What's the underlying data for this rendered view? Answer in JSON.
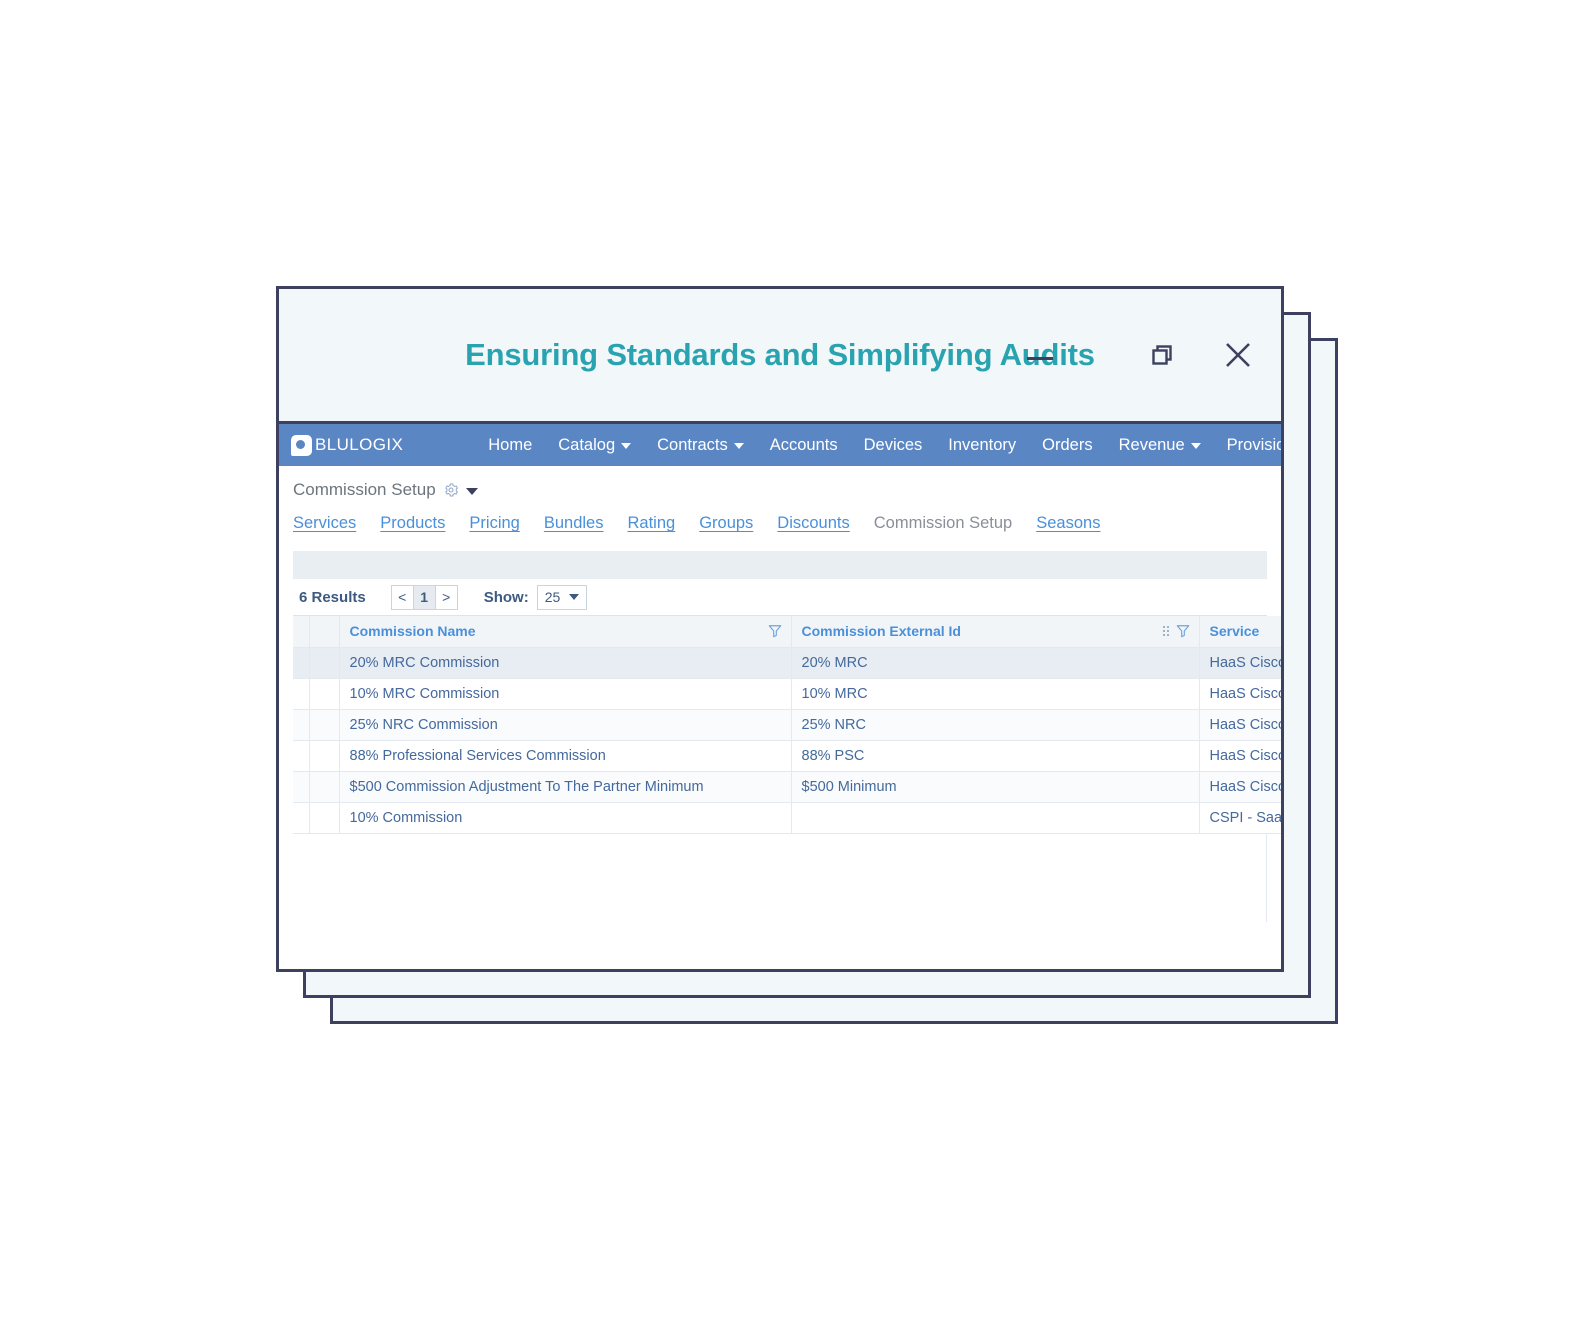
{
  "window": {
    "title": "Ensuring Standards and Simplifying Audits",
    "controls": {
      "minimize": "minimize",
      "restore": "restore",
      "close": "close"
    },
    "accent_color": "#2aa3b0",
    "border_color": "#3d405e",
    "chrome_bg": "#f2f8f9"
  },
  "navbar": {
    "brand": "BLULOGIX",
    "bg_color": "#5b86c4",
    "items": [
      {
        "label": "Home",
        "has_caret": false
      },
      {
        "label": "Catalog",
        "has_caret": true
      },
      {
        "label": "Contracts",
        "has_caret": true
      },
      {
        "label": "Accounts",
        "has_caret": false
      },
      {
        "label": "Devices",
        "has_caret": false
      },
      {
        "label": "Inventory",
        "has_caret": false
      },
      {
        "label": "Orders",
        "has_caret": false
      },
      {
        "label": "Revenue",
        "has_caret": true
      },
      {
        "label": "Provisioning",
        "has_caret": false
      }
    ]
  },
  "page": {
    "title": "Commission Setup",
    "settings_icon": "gear-icon",
    "settings_caret": "chevron-down-icon"
  },
  "subtabs": [
    {
      "label": "Services",
      "active": false
    },
    {
      "label": "Products",
      "active": false
    },
    {
      "label": "Pricing",
      "active": false
    },
    {
      "label": "Bundles",
      "active": false
    },
    {
      "label": "Rating",
      "active": false
    },
    {
      "label": "Groups",
      "active": false
    },
    {
      "label": "Discounts",
      "active": false
    },
    {
      "label": "Commission Setup",
      "active": true
    },
    {
      "label": "Seasons",
      "active": false
    }
  ],
  "results_bar": {
    "count_label": "6 Results",
    "pager": {
      "prev": "<",
      "current_page": "1",
      "next": ">"
    },
    "show_label": "Show:",
    "show_value": "25"
  },
  "table": {
    "columns": [
      {
        "label": "Commission Name",
        "filter_icon": "funnel-icon",
        "drag_handle": false
      },
      {
        "label": "Commission External Id",
        "filter_icon": "funnel-icon",
        "drag_handle": true
      },
      {
        "label": "Service",
        "filter_icon": null,
        "drag_handle": false
      }
    ],
    "rows": [
      {
        "name": "20% MRC Commission",
        "external_id": "20% MRC",
        "service": "HaaS Cisco"
      },
      {
        "name": "10% MRC Commission",
        "external_id": "10% MRC",
        "service": "HaaS Cisco"
      },
      {
        "name": "25% NRC Commission",
        "external_id": "25% NRC",
        "service": "HaaS Cisco"
      },
      {
        "name": "88% Professional Services Commission",
        "external_id": "88% PSC",
        "service": "HaaS Cisco"
      },
      {
        "name": "$500 Commission Adjustment To The Partner Minimum",
        "external_id": "$500 Minimum",
        "service": "HaaS Cisco"
      },
      {
        "name": "10% Commission",
        "external_id": "",
        "service": "CSPI - SaaS"
      }
    ]
  }
}
